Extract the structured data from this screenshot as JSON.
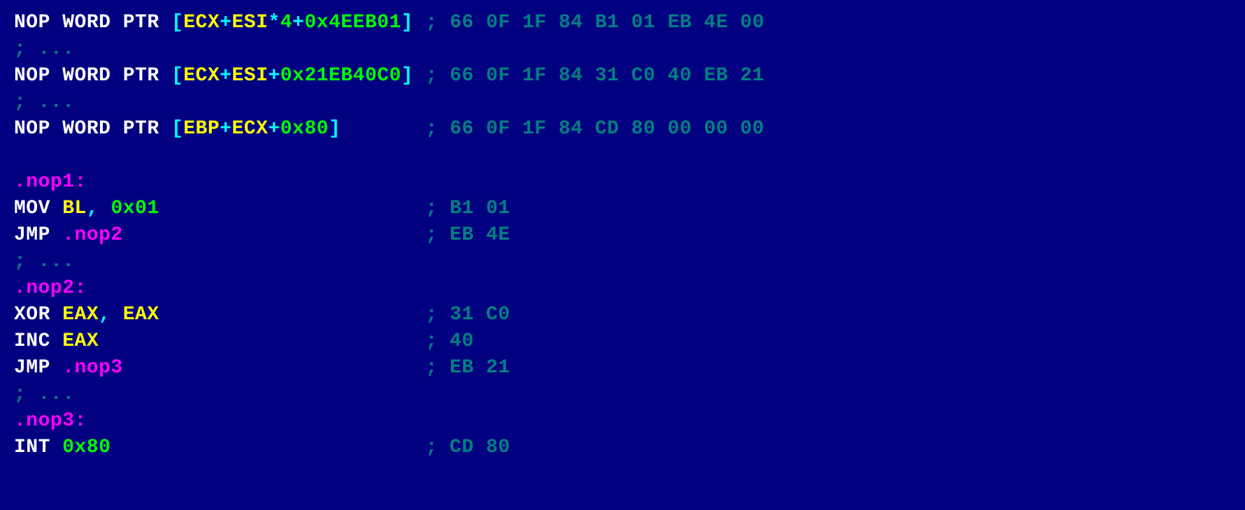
{
  "lines": [
    {
      "col1": [
        {
          "c": "mn",
          "t": "NOP WORD PTR "
        },
        {
          "c": "pu",
          "t": "["
        },
        {
          "c": "rg",
          "t": "ECX"
        },
        {
          "c": "pu",
          "t": "+"
        },
        {
          "c": "rg",
          "t": "ESI"
        },
        {
          "c": "pu",
          "t": "*"
        },
        {
          "c": "nm",
          "t": "4"
        },
        {
          "c": "pu",
          "t": "+"
        },
        {
          "c": "nm",
          "t": "0x4EEB01"
        },
        {
          "c": "pu",
          "t": "]"
        }
      ],
      "col2": "; 66 0F 1F 84 B1 01 EB 4E 00"
    },
    {
      "col1": [
        {
          "c": "cm",
          "t": "; ..."
        }
      ]
    },
    {
      "col1": [
        {
          "c": "mn",
          "t": "NOP WORD PTR "
        },
        {
          "c": "pu",
          "t": "["
        },
        {
          "c": "rg",
          "t": "ECX"
        },
        {
          "c": "pu",
          "t": "+"
        },
        {
          "c": "rg",
          "t": "ESI"
        },
        {
          "c": "pu",
          "t": "+"
        },
        {
          "c": "nm",
          "t": "0x21EB40C0"
        },
        {
          "c": "pu",
          "t": "]"
        }
      ],
      "col2": "; 66 0F 1F 84 31 C0 40 EB 21"
    },
    {
      "col1": [
        {
          "c": "cm",
          "t": "; ..."
        }
      ]
    },
    {
      "col1": [
        {
          "c": "mn",
          "t": "NOP WORD PTR "
        },
        {
          "c": "pu",
          "t": "["
        },
        {
          "c": "rg",
          "t": "EBP"
        },
        {
          "c": "pu",
          "t": "+"
        },
        {
          "c": "rg",
          "t": "ECX"
        },
        {
          "c": "pu",
          "t": "+"
        },
        {
          "c": "nm",
          "t": "0x80"
        },
        {
          "c": "pu",
          "t": "]"
        }
      ],
      "col2": "; 66 0F 1F 84 CD 80 00 00 00"
    },
    {
      "col1": [
        {
          "c": "mn",
          "t": ""
        }
      ]
    },
    {
      "col1": [
        {
          "c": "lb",
          "t": ".nop1:"
        }
      ]
    },
    {
      "col1": [
        {
          "c": "mn",
          "t": "MOV "
        },
        {
          "c": "rg",
          "t": "BL"
        },
        {
          "c": "pu",
          "t": ", "
        },
        {
          "c": "nm",
          "t": "0x01"
        }
      ],
      "col2": "; B1 01"
    },
    {
      "col1": [
        {
          "c": "mn",
          "t": "JMP "
        },
        {
          "c": "lb",
          "t": ".nop2"
        }
      ],
      "col2": "; EB 4E"
    },
    {
      "col1": [
        {
          "c": "cm",
          "t": "; ..."
        }
      ]
    },
    {
      "col1": [
        {
          "c": "lb",
          "t": ".nop2:"
        }
      ]
    },
    {
      "col1": [
        {
          "c": "mn",
          "t": "XOR "
        },
        {
          "c": "rg",
          "t": "EAX"
        },
        {
          "c": "pu",
          "t": ", "
        },
        {
          "c": "rg",
          "t": "EAX"
        }
      ],
      "col2": "; 31 C0"
    },
    {
      "col1": [
        {
          "c": "mn",
          "t": "INC "
        },
        {
          "c": "rg",
          "t": "EAX"
        }
      ],
      "col2": "; 40"
    },
    {
      "col1": [
        {
          "c": "mn",
          "t": "JMP "
        },
        {
          "c": "lb",
          "t": ".nop3"
        }
      ],
      "col2": "; EB 21"
    },
    {
      "col1": [
        {
          "c": "cm",
          "t": "; ..."
        }
      ]
    },
    {
      "col1": [
        {
          "c": "lb",
          "t": ".nop3:"
        }
      ]
    },
    {
      "col1": [
        {
          "c": "mn",
          "t": "INT "
        },
        {
          "c": "nm",
          "t": "0x80"
        }
      ],
      "col2": "; CD 80"
    }
  ],
  "commentColumn": 34
}
